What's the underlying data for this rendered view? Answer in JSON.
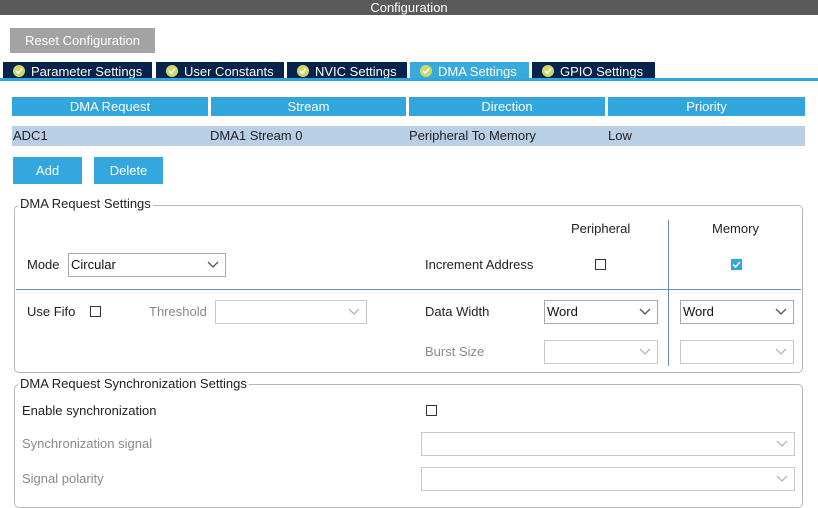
{
  "window": {
    "title": "Configuration"
  },
  "toolbar": {
    "reset_label": "Reset Configuration"
  },
  "tabs": [
    {
      "label": "Parameter Settings",
      "active": false
    },
    {
      "label": "User Constants",
      "active": false
    },
    {
      "label": "NVIC Settings",
      "active": false
    },
    {
      "label": "DMA Settings",
      "active": true
    },
    {
      "label": "GPIO Settings",
      "active": false
    }
  ],
  "table": {
    "columns": [
      "DMA Request",
      "Stream",
      "Direction",
      "Priority"
    ],
    "rows": [
      {
        "request": "ADC1",
        "stream": "DMA1 Stream 0",
        "direction": "Peripheral To Memory",
        "priority": "Low"
      }
    ]
  },
  "actions": {
    "add_label": "Add",
    "delete_label": "Delete"
  },
  "request_settings": {
    "title": "DMA Request Settings",
    "peripheral_header": "Peripheral",
    "memory_header": "Memory",
    "mode_label": "Mode",
    "mode_value": "Circular",
    "increment_address_label": "Increment Address",
    "increment_peripheral_checked": false,
    "increment_memory_checked": true,
    "use_fifo_label": "Use Fifo",
    "use_fifo_checked": false,
    "threshold_label": "Threshold",
    "threshold_value": "",
    "data_width_label": "Data Width",
    "peripheral_data_width": "Word",
    "memory_data_width": "Word",
    "burst_size_label": "Burst Size",
    "peripheral_burst_size": "",
    "memory_burst_size": ""
  },
  "sync_settings": {
    "title": "DMA Request Synchronization Settings",
    "enable_label": "Enable synchronization",
    "enable_checked": false,
    "signal_label": "Synchronization signal",
    "signal_value": "",
    "polarity_label": "Signal polarity",
    "polarity_value": ""
  },
  "colors": {
    "accent": "#31a6dc",
    "tab_dark": "#06234b",
    "selected_row": "#b8cfe5",
    "title_bar": "#5a5a5a"
  }
}
